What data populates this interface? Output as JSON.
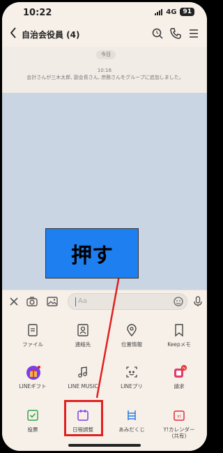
{
  "status_bar": {
    "time": "10:22",
    "network": "4G",
    "battery": "91"
  },
  "header": {
    "back_icon": "chevron-left-icon",
    "title": "自治会役員 (4)",
    "icons": [
      "search-icon",
      "phone-icon",
      "menu-icon"
    ]
  },
  "chat": {
    "date_label": "今日",
    "system_time": "10:16",
    "system_message": "会計さんが三木太郎, 副会長さん, 庶務さんをグループに追加しました。"
  },
  "overlay": {
    "label": "押す",
    "color": "#1e7ff0",
    "highlight_color": "#e02020"
  },
  "input_bar": {
    "icons": [
      "close-icon",
      "camera-icon",
      "image-icon",
      "emoji-icon",
      "mic-icon"
    ],
    "placeholder": "Aa"
  },
  "menu": {
    "items": [
      {
        "label": "ファイル",
        "icon": "file-icon"
      },
      {
        "label": "連絡先",
        "icon": "contact-icon"
      },
      {
        "label": "位置情報",
        "icon": "location-icon"
      },
      {
        "label": "Keepメモ",
        "icon": "bookmark-icon"
      },
      {
        "label": "LINEギフト",
        "icon": "gift-icon"
      },
      {
        "label": "LINE MUSIC",
        "icon": "music-icon"
      },
      {
        "label": "LINEプリ",
        "icon": "camera-print-icon"
      },
      {
        "label": "請求",
        "icon": "bill-icon",
        "badge": "N"
      },
      {
        "label": "投票",
        "icon": "vote-icon"
      },
      {
        "label": "日程調整",
        "icon": "calendar-icon"
      },
      {
        "label": "あみだくじ",
        "icon": "amida-icon"
      },
      {
        "label": "Y!カレンダー\n(共有)",
        "icon": "yahoo-calendar-icon"
      }
    ]
  },
  "colors": {
    "background": "#f7f0e9",
    "chat_background": "#c9d5e2",
    "accent_green": "#2fa64a",
    "accent_purple": "#7b3fe4"
  }
}
